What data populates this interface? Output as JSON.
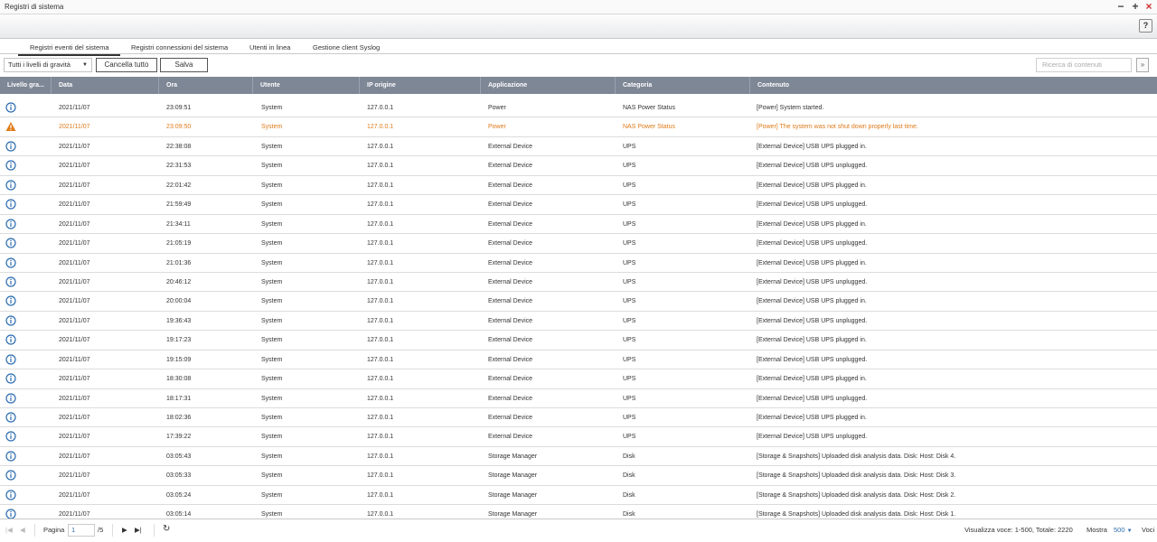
{
  "window": {
    "title": "Registri di sistema"
  },
  "help_label": "?",
  "tabs": [
    {
      "label": "Registri eventi del sistema"
    },
    {
      "label": "Registri connessioni del sistema"
    },
    {
      "label": "Utenti in linea"
    },
    {
      "label": "Gestione client Syslog"
    }
  ],
  "toolbar": {
    "severity_filter": "Tutti i livelli di gravità",
    "clear_all": "Cancella tutto",
    "save": "Salva",
    "search_placeholder": "Ricerca di contenuti"
  },
  "columns": [
    "Livello gra...",
    "Data",
    "Ora",
    "Utente",
    "IP origine",
    "Applicazione",
    "Categoria",
    "Contenuto"
  ],
  "rows": [
    {
      "level": "info",
      "date": "2021/11/07",
      "time": "23:09:51",
      "user": "System",
      "ip": "127.0.0.1",
      "app": "Power",
      "category": "NAS Power Status",
      "content": "[Power] System started."
    },
    {
      "level": "warning",
      "date": "2021/11/07",
      "time": "23:09:50",
      "user": "System",
      "ip": "127.0.0.1",
      "app": "Power",
      "category": "NAS Power Status",
      "content": "[Power] The system was not shut down properly last time."
    },
    {
      "level": "info",
      "date": "2021/11/07",
      "time": "22:38:08",
      "user": "System",
      "ip": "127.0.0.1",
      "app": "External Device",
      "category": "UPS",
      "content": "[External Device] USB UPS plugged in."
    },
    {
      "level": "info",
      "date": "2021/11/07",
      "time": "22:31:53",
      "user": "System",
      "ip": "127.0.0.1",
      "app": "External Device",
      "category": "UPS",
      "content": "[External Device] USB UPS unplugged."
    },
    {
      "level": "info",
      "date": "2021/11/07",
      "time": "22:01:42",
      "user": "System",
      "ip": "127.0.0.1",
      "app": "External Device",
      "category": "UPS",
      "content": "[External Device] USB UPS plugged in."
    },
    {
      "level": "info",
      "date": "2021/11/07",
      "time": "21:59:49",
      "user": "System",
      "ip": "127.0.0.1",
      "app": "External Device",
      "category": "UPS",
      "content": "[External Device] USB UPS unplugged."
    },
    {
      "level": "info",
      "date": "2021/11/07",
      "time": "21:34:11",
      "user": "System",
      "ip": "127.0.0.1",
      "app": "External Device",
      "category": "UPS",
      "content": "[External Device] USB UPS plugged in."
    },
    {
      "level": "info",
      "date": "2021/11/07",
      "time": "21:05:19",
      "user": "System",
      "ip": "127.0.0.1",
      "app": "External Device",
      "category": "UPS",
      "content": "[External Device] USB UPS unplugged."
    },
    {
      "level": "info",
      "date": "2021/11/07",
      "time": "21:01:36",
      "user": "System",
      "ip": "127.0.0.1",
      "app": "External Device",
      "category": "UPS",
      "content": "[External Device] USB UPS plugged in."
    },
    {
      "level": "info",
      "date": "2021/11/07",
      "time": "20:46:12",
      "user": "System",
      "ip": "127.0.0.1",
      "app": "External Device",
      "category": "UPS",
      "content": "[External Device] USB UPS unplugged."
    },
    {
      "level": "info",
      "date": "2021/11/07",
      "time": "20:00:04",
      "user": "System",
      "ip": "127.0.0.1",
      "app": "External Device",
      "category": "UPS",
      "content": "[External Device] USB UPS plugged in."
    },
    {
      "level": "info",
      "date": "2021/11/07",
      "time": "19:36:43",
      "user": "System",
      "ip": "127.0.0.1",
      "app": "External Device",
      "category": "UPS",
      "content": "[External Device] USB UPS unplugged."
    },
    {
      "level": "info",
      "date": "2021/11/07",
      "time": "19:17:23",
      "user": "System",
      "ip": "127.0.0.1",
      "app": "External Device",
      "category": "UPS",
      "content": "[External Device] USB UPS plugged in."
    },
    {
      "level": "info",
      "date": "2021/11/07",
      "time": "19:15:09",
      "user": "System",
      "ip": "127.0.0.1",
      "app": "External Device",
      "category": "UPS",
      "content": "[External Device] USB UPS unplugged."
    },
    {
      "level": "info",
      "date": "2021/11/07",
      "time": "18:30:08",
      "user": "System",
      "ip": "127.0.0.1",
      "app": "External Device",
      "category": "UPS",
      "content": "[External Device] USB UPS plugged in."
    },
    {
      "level": "info",
      "date": "2021/11/07",
      "time": "18:17:31",
      "user": "System",
      "ip": "127.0.0.1",
      "app": "External Device",
      "category": "UPS",
      "content": "[External Device] USB UPS unplugged."
    },
    {
      "level": "info",
      "date": "2021/11/07",
      "time": "18:02:36",
      "user": "System",
      "ip": "127.0.0.1",
      "app": "External Device",
      "category": "UPS",
      "content": "[External Device] USB UPS plugged in."
    },
    {
      "level": "info",
      "date": "2021/11/07",
      "time": "17:39:22",
      "user": "System",
      "ip": "127.0.0.1",
      "app": "External Device",
      "category": "UPS",
      "content": "[External Device] USB UPS unplugged."
    },
    {
      "level": "info",
      "date": "2021/11/07",
      "time": "03:05:43",
      "user": "System",
      "ip": "127.0.0.1",
      "app": "Storage Manager",
      "category": "Disk",
      "content": "[Storage & Snapshots] Uploaded disk analysis data. Disk: Host: Disk 4."
    },
    {
      "level": "info",
      "date": "2021/11/07",
      "time": "03:05:33",
      "user": "System",
      "ip": "127.0.0.1",
      "app": "Storage Manager",
      "category": "Disk",
      "content": "[Storage & Snapshots] Uploaded disk analysis data. Disk: Host: Disk 3."
    },
    {
      "level": "info",
      "date": "2021/11/07",
      "time": "03:05:24",
      "user": "System",
      "ip": "127.0.0.1",
      "app": "Storage Manager",
      "category": "Disk",
      "content": "[Storage & Snapshots] Uploaded disk analysis data. Disk: Host: Disk 2."
    },
    {
      "level": "info",
      "date": "2021/11/07",
      "time": "03:05:14",
      "user": "System",
      "ip": "127.0.0.1",
      "app": "Storage Manager",
      "category": "Disk",
      "content": "[Storage & Snapshots] Uploaded disk analysis data. Disk: Host: Disk 1."
    }
  ],
  "pagination": {
    "page_label": "Pagina",
    "page": "1",
    "total_pages": "/5",
    "display_info": "Visualizza voce: 1-500, Totale: 2220",
    "show_label": "Mostra",
    "per_page": "500",
    "items_label": "Voci"
  },
  "colors": {
    "header_bg": "#7e8796",
    "warning": "#e07b1a",
    "info": "#2b6cb0"
  }
}
